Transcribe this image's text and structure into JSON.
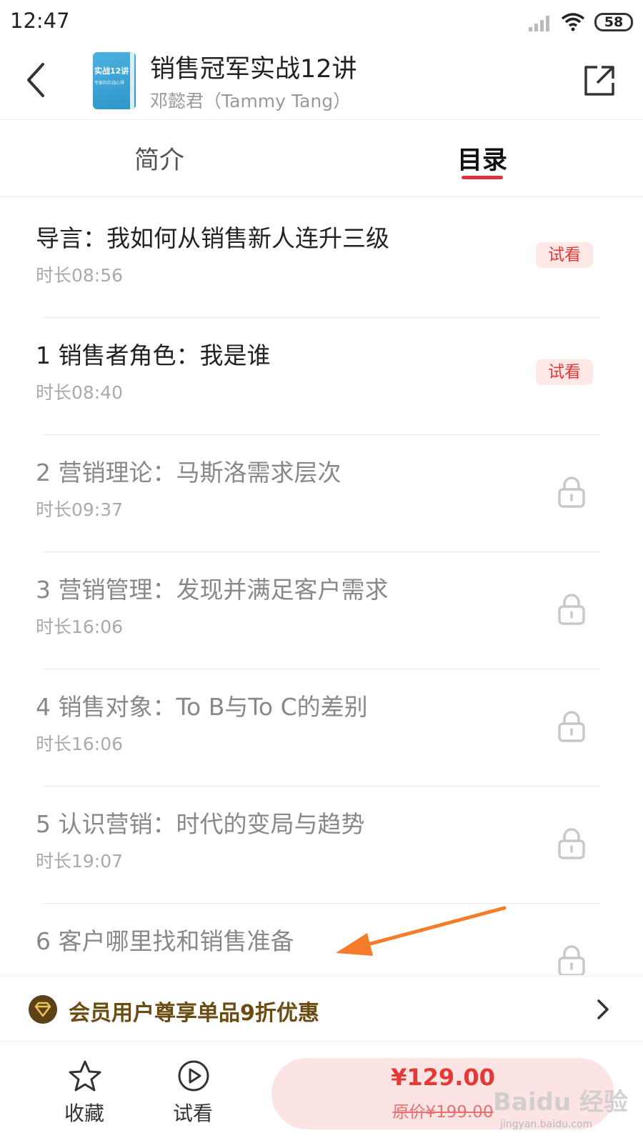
{
  "status_bar": {
    "time": "12:47",
    "battery": "58"
  },
  "header": {
    "title": "销售冠军实战12讲",
    "author": "邓懿君（Tammy Tang）",
    "cover_text": "实战12讲",
    "cover_subtext": "专家的实战心得"
  },
  "tabs": [
    {
      "label": "简介",
      "active": false
    },
    {
      "label": "目录",
      "active": true
    }
  ],
  "lessons": [
    {
      "title": "导言：我如何从销售新人连升三级",
      "duration": "时长08:56",
      "badge": "试看",
      "locked": false
    },
    {
      "title": "1 销售者角色：我是谁",
      "duration": "时长08:40",
      "badge": "试看",
      "locked": false
    },
    {
      "title": "2 营销理论：马斯洛需求层次",
      "duration": "时长09:37",
      "locked": true
    },
    {
      "title": "3 营销管理：发现并满足客户需求",
      "duration": "时长16:06",
      "locked": true
    },
    {
      "title": "4 销售对象：To B与To C的差别",
      "duration": "时长16:06",
      "locked": true
    },
    {
      "title": "5 认识营销：时代的变局与趋势",
      "duration": "时长19:07",
      "locked": true
    },
    {
      "title": "6 客户哪里找和销售准备",
      "duration": "",
      "locked": true
    }
  ],
  "vip_banner": {
    "text": "会员用户尊享单品9折优惠"
  },
  "bottom_bar": {
    "favorite_label": "收藏",
    "trial_label": "试看",
    "price": "¥129.00",
    "original_price": "原价¥199.00"
  },
  "watermark": {
    "text": "Baidu 经验",
    "url": "jingyan.baidu.com"
  },
  "colors": {
    "accent": "#e0313c",
    "vip_text": "#6a4b12",
    "buy_bg": "#fde4e4",
    "arrow": "#f57c2a"
  }
}
